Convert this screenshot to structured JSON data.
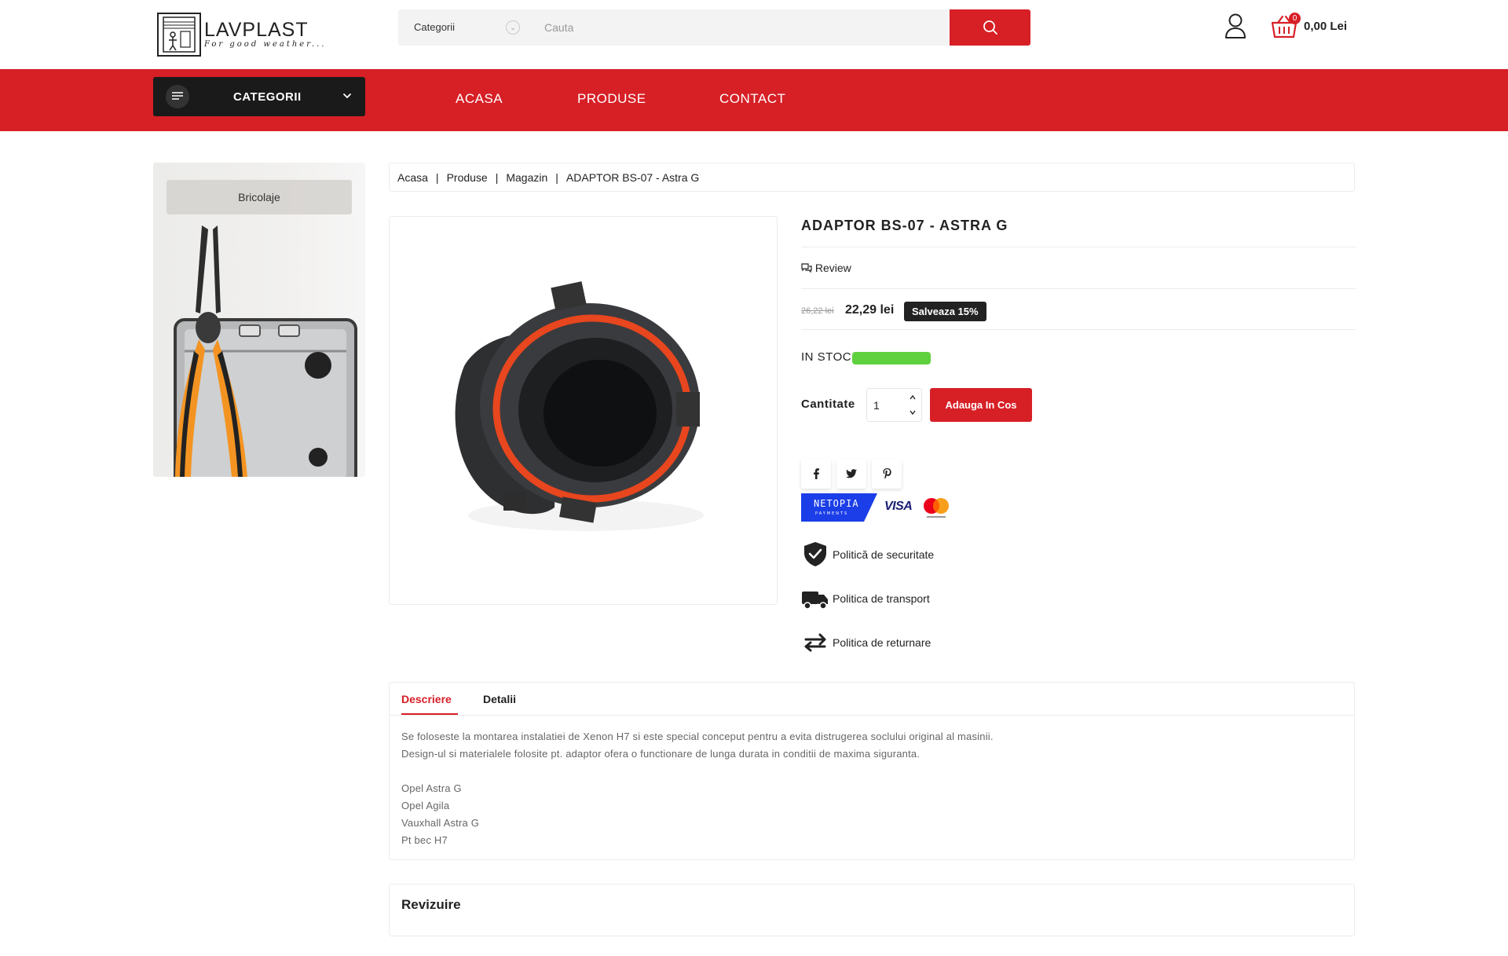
{
  "header": {
    "logo_title": "LAVPLAST",
    "logo_tagline": "For good weather...",
    "search": {
      "category": "Categorii",
      "placeholder": "Cauta"
    },
    "cart": {
      "count": "0",
      "total": "0,00 Lei"
    }
  },
  "nav": {
    "categories_label": "CATEGORII",
    "links": [
      "ACASA",
      "PRODUSE",
      "CONTACT"
    ]
  },
  "sidebar": {
    "promo_label": "Bricolaje"
  },
  "breadcrumb": [
    "Acasa",
    "Produse",
    "Magazin",
    "ADAPTOR BS-07 - Astra G"
  ],
  "product": {
    "title": "ADAPTOR BS-07 - ASTRA G",
    "review_label": "Review",
    "price_old": "26,22 lei",
    "price_new": "22,29 lei",
    "discount_badge": "Salveaza 15%",
    "stock_label": "IN STOC",
    "quantity_label": "Cantitate",
    "quantity_value": "1",
    "add_to_cart": "Adauga In Cos",
    "payment": {
      "netopia": "NETOPIA",
      "netopia_sub": "PAYMENTS",
      "visa": "VISA"
    },
    "policies": [
      "Politică de securitate",
      "Politica de transport",
      "Politica de returnare"
    ]
  },
  "tabs": {
    "labels": [
      "Descriere",
      "Detalii"
    ],
    "description_lines": [
      "Se foloseste la montarea instalatiei de Xenon H7 si este special conceput pentru a evita distrugerea soclului original al masinii.",
      "Design-ul si materialele folosite pt. adaptor ofera o functionare de lunga durata in conditii de maxima siguranta.",
      "",
      "Opel Astra G",
      "Opel Agila",
      "Vauxhall Astra G",
      "Pt bec H7"
    ]
  },
  "reviews": {
    "title": "Revizuire"
  },
  "colors": {
    "brand_red": "#d71f26",
    "dark": "#1a1a1a",
    "stock_green": "#5fd03e"
  }
}
